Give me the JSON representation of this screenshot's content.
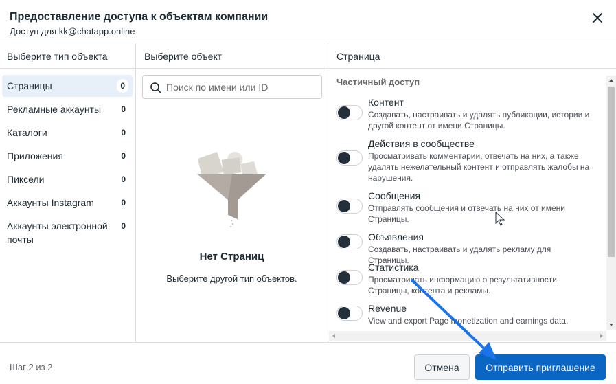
{
  "dialog": {
    "title": "Предоставление доступа к объектам компании",
    "subtitle": "Доступ для kk@chatapp.online"
  },
  "columns": {
    "type": "Выберите тип объекта",
    "object": "Выберите объект",
    "page": "Страница"
  },
  "object_types": [
    {
      "label": "Страницы",
      "count": "0",
      "active": true
    },
    {
      "label": "Рекламные аккаунты",
      "count": "0"
    },
    {
      "label": "Каталоги",
      "count": "0"
    },
    {
      "label": "Приложения",
      "count": "0"
    },
    {
      "label": "Пиксели",
      "count": "0"
    },
    {
      "label": "Аккаунты Instagram",
      "count": "0"
    },
    {
      "label": "Аккаунты электронной почты",
      "count": "0"
    }
  ],
  "search": {
    "placeholder": "Поиск по имени или ID"
  },
  "empty_state": {
    "title": "Нет Страниц",
    "description": "Выберите другой тип объектов."
  },
  "permissions": {
    "section_label": "Частичный доступ",
    "items": [
      {
        "title": "Контент",
        "description": "Создавать, настраивать и удалять публикации, истории и другой контент от имени Страницы.",
        "enabled": false
      },
      {
        "title": "Действия в сообществе",
        "description": "Просматривать комментарии, отвечать на них, а также удалять нежелательный контент и отправлять жалобы на нарушения.",
        "enabled": false
      },
      {
        "title": "Сообщения",
        "description": "Отправлять сообщения и отвечать на них от имени Страницы.",
        "enabled": false
      },
      {
        "title": "Объявления",
        "description": "Создавать, настраивать и удалять рекламу для Страницы.",
        "enabled": false
      },
      {
        "title": "Статистика",
        "description": "Просматривать информацию о результативности Страницы, контента и рекламы.",
        "enabled": false
      },
      {
        "title": "Revenue",
        "description": "View and export Page monetization and earnings data.",
        "enabled": false
      }
    ]
  },
  "footer": {
    "step": "Шаг 2 из 2",
    "cancel_label": "Отмена",
    "send_label": "Отправить приглашение"
  },
  "colors": {
    "primary": "#0a66c2",
    "annotation_arrow": "#1a73e8",
    "active_item_bg": "#e7f0f9",
    "toggle_knob": "#23303b"
  },
  "icons": {
    "close": "close-icon",
    "search": "search-icon",
    "empty": "funnel-illustration",
    "cursor": "mouse-cursor-icon",
    "annotation": "arrow-annotation"
  }
}
